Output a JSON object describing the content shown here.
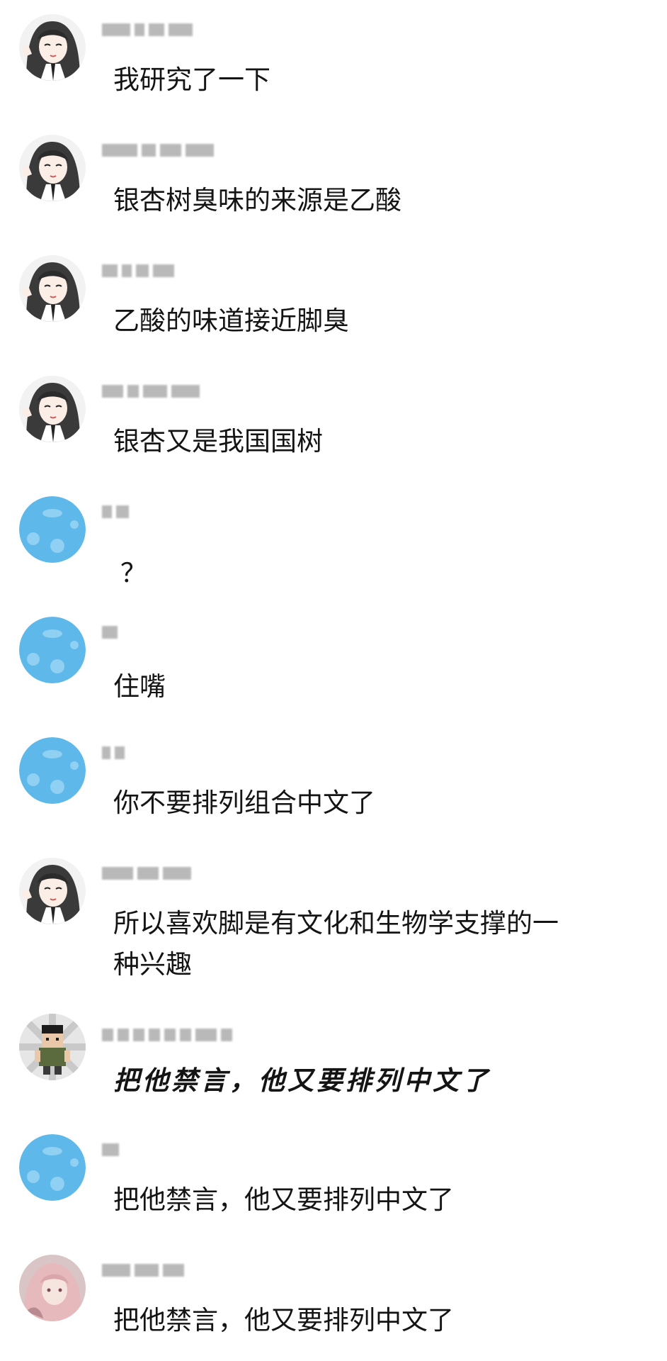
{
  "messages": [
    {
      "avatar": "anime-girl-avatar",
      "text": "我研究了一下"
    },
    {
      "avatar": "anime-girl-avatar",
      "text": "银杏树臭味的来源是乙酸"
    },
    {
      "avatar": "anime-girl-avatar",
      "text": "乙酸的味道接近脚臭"
    },
    {
      "avatar": "anime-girl-avatar",
      "text": "银杏又是我国国树"
    },
    {
      "avatar": "blue-bubble-avatar",
      "text": "？"
    },
    {
      "avatar": "blue-bubble-avatar",
      "text": "住嘴"
    },
    {
      "avatar": "blue-bubble-avatar",
      "text": "你不要排列组合中文了"
    },
    {
      "avatar": "anime-girl-avatar",
      "text": "所以喜欢脚是有文化和生物学支撑的一\n种兴趣"
    },
    {
      "avatar": "pixel-soldier-avatar",
      "text": "把他禁言，他又要排列中文了"
    },
    {
      "avatar": "blue-bubble-avatar",
      "text": "把他禁言，他又要排列中文了"
    },
    {
      "avatar": "pink-hair-girl-avatar",
      "text": "把他禁言，他又要排列中文了"
    }
  ],
  "colors": {
    "text": "#141414",
    "blurred_name": "#b9b9b9",
    "blue_avatar": "#5fb8ea",
    "background": "#ffffff"
  }
}
